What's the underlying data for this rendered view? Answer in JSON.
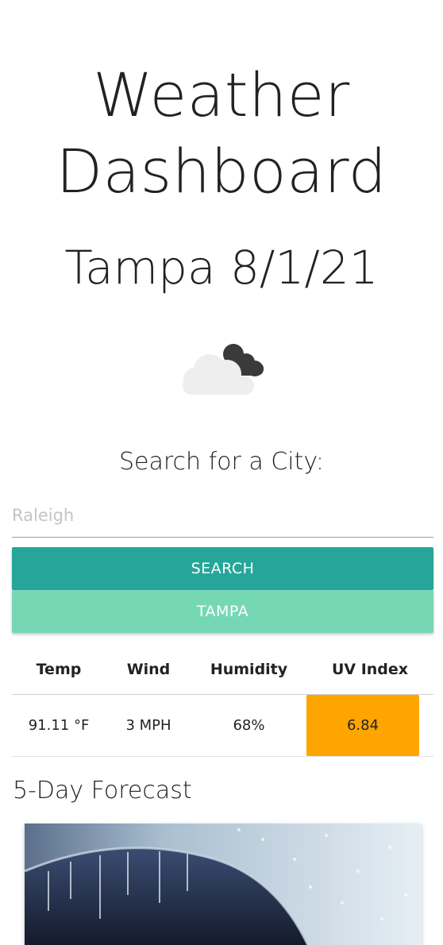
{
  "header": {
    "title_line1": "Weather",
    "title_line2": "Dashboard",
    "city_date": "Tampa 8/1/21"
  },
  "current": {
    "icon": "clouds-icon"
  },
  "search": {
    "label": "Search for a City:",
    "placeholder": "Raleigh",
    "value": "",
    "button_label": "SEARCH"
  },
  "history": {
    "items": [
      {
        "label": "TAMPA"
      }
    ]
  },
  "stats": {
    "headers": [
      "Temp",
      "Wind",
      "Humidity",
      "UV Index"
    ],
    "values": [
      "91.11 °F",
      "3 MPH",
      "68%",
      "6.84"
    ],
    "uv_color": "#ffa500"
  },
  "forecast": {
    "title": "5-Day Forecast",
    "card_image": "rain-umbrella-photo"
  },
  "colors": {
    "search_button": "#26a69a",
    "history_button": "#76d7b5",
    "uv_moderate": "#ffa500"
  }
}
